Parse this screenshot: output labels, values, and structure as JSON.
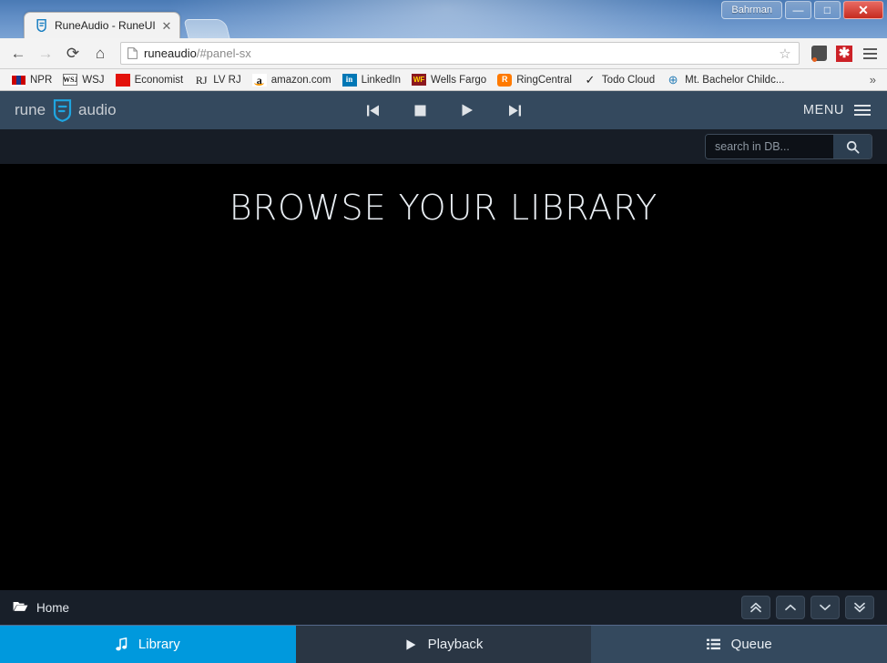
{
  "browser": {
    "window_user_button": "Bahrman",
    "window_controls": {
      "minimize": "—",
      "maximize": "□",
      "close": "✕"
    },
    "tab": {
      "title": "RuneAudio - RuneUI",
      "favicon": "runeaudio-favicon",
      "close": "✕"
    },
    "nav": {
      "back": "←",
      "forward": "→",
      "reload": "⟳",
      "home": "⌂"
    },
    "omnibox": {
      "page_icon": "page-icon",
      "url_domain": "runeaudio",
      "url_path": "/#panel-sx",
      "url_full": "runeaudio/#panel-sx",
      "star": "☆"
    },
    "extensions": [
      {
        "name": "evernote-extension",
        "label": ""
      },
      {
        "name": "asterisk-extension",
        "label": "✱"
      }
    ],
    "bookmarks": [
      {
        "label": "NPR",
        "icon": "npr-icon"
      },
      {
        "label": "WSJ",
        "icon": "wsj-icon",
        "glyph": "WSJ"
      },
      {
        "label": "Economist",
        "icon": "economist-icon"
      },
      {
        "label": "LV RJ",
        "icon": "rj-icon",
        "glyph": "RJ"
      },
      {
        "label": "amazon.com",
        "icon": "amazon-icon",
        "glyph": "a"
      },
      {
        "label": "LinkedIn",
        "icon": "linkedin-icon",
        "glyph": "in"
      },
      {
        "label": "Wells Fargo",
        "icon": "wellsfargo-icon",
        "glyph": "WF"
      },
      {
        "label": "RingCentral",
        "icon": "ringcentral-icon",
        "glyph": "R"
      },
      {
        "label": "Todo Cloud",
        "icon": "todocloud-icon",
        "glyph": "✓"
      },
      {
        "label": "Mt. Bachelor Childc...",
        "icon": "globe-icon",
        "glyph": "⊕"
      }
    ],
    "bookmarks_overflow": "»"
  },
  "app": {
    "brand": {
      "prefix": "rune",
      "suffix": "audio"
    },
    "transport": [
      {
        "name": "previous-track-button",
        "glyph": "⏮"
      },
      {
        "name": "stop-button",
        "glyph": "⏹"
      },
      {
        "name": "play-button",
        "glyph": "▶"
      },
      {
        "name": "next-track-button",
        "glyph": "⏭"
      }
    ],
    "menu_label": "MENU",
    "search": {
      "placeholder": "search in DB...",
      "value": "",
      "button_glyph": "🔍"
    },
    "content": {
      "heading": "BROWSE YOUR LIBRARY"
    },
    "footer": {
      "path_label": "Home",
      "scroll_buttons": [
        {
          "name": "scroll-top-button",
          "glyph": "⌃⌃"
        },
        {
          "name": "scroll-up-button",
          "glyph": "⌃"
        },
        {
          "name": "scroll-down-button",
          "glyph": "⌄"
        },
        {
          "name": "scroll-bottom-button",
          "glyph": "⌄⌄"
        }
      ]
    },
    "tabs": [
      {
        "label": "Library",
        "icon": "music-note-icon",
        "glyph": "♫",
        "active": true
      },
      {
        "label": "Playback",
        "icon": "play-icon",
        "glyph": "▶",
        "active": false
      },
      {
        "label": "Queue",
        "icon": "list-icon",
        "glyph": "☰",
        "active": false
      }
    ],
    "colors": {
      "accent": "#0099dd",
      "header": "#34495e",
      "footer": "#181f29",
      "content_bg": "#000000"
    }
  }
}
